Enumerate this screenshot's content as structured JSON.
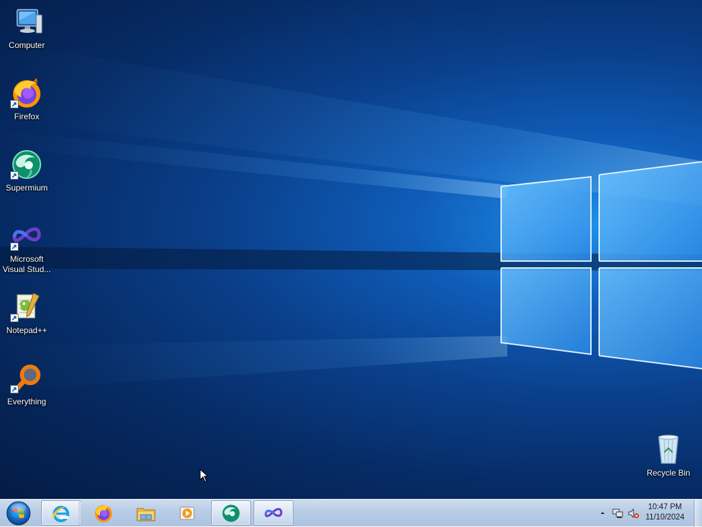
{
  "desktop": {
    "icons": [
      {
        "label": "Computer",
        "icon": "computer-icon"
      },
      {
        "label": "Firefox",
        "icon": "firefox-icon"
      },
      {
        "label": "Supermium",
        "icon": "supermium-icon"
      },
      {
        "label": "Microsoft Visual Stud...",
        "icon": "visual-studio-icon"
      },
      {
        "label": "Notepad++",
        "icon": "notepad-plus-plus-icon"
      },
      {
        "label": "Everything",
        "icon": "everything-search-icon"
      }
    ],
    "recycle_bin": {
      "label": "Recycle Bin",
      "icon": "recycle-bin-icon"
    }
  },
  "taskbar": {
    "start": {
      "icon": "windows-start-orb-icon"
    },
    "pinned": [
      {
        "name": "Internet Explorer",
        "icon": "internet-explorer-icon",
        "active": true
      },
      {
        "name": "Firefox",
        "icon": "firefox-icon",
        "active": false
      },
      {
        "name": "Windows Explorer",
        "icon": "folder-icon",
        "active": false
      },
      {
        "name": "Windows Media Player",
        "icon": "media-player-icon",
        "active": false
      },
      {
        "name": "Supermium",
        "icon": "supermium-icon",
        "active": true
      },
      {
        "name": "Microsoft Visual Studio",
        "icon": "visual-studio-icon",
        "active": true
      }
    ],
    "tray": {
      "icons": [
        "show-hidden-icons-chevron-icon",
        "network-icon",
        "volume-muted-icon"
      ],
      "time": "10:47 PM",
      "date": "11/10/2024"
    }
  },
  "colors": {
    "wallpaper_base": "#062a63",
    "wallpaper_glow": "#1e8fe8",
    "taskbar": "#b9cde6"
  }
}
